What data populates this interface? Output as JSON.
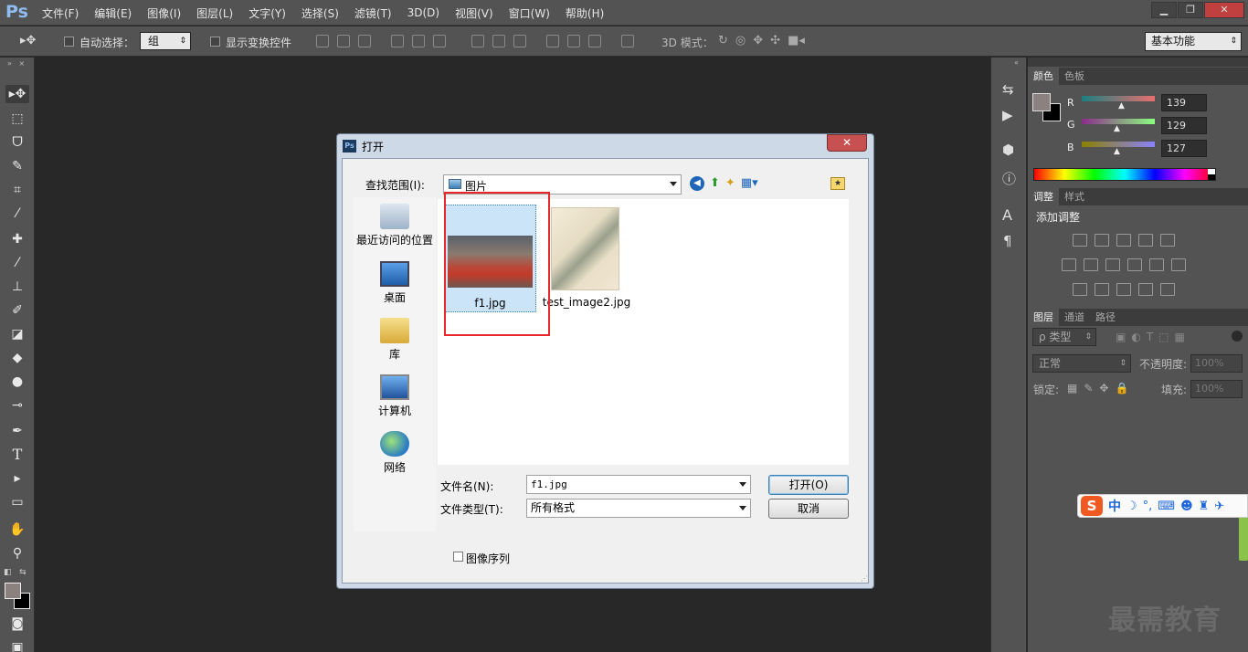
{
  "app": {
    "logo": "Ps",
    "menus": [
      "文件(F)",
      "编辑(E)",
      "图像(I)",
      "图层(L)",
      "文字(Y)",
      "选择(S)",
      "滤镜(T)",
      "3D(D)",
      "视图(V)",
      "窗口(W)",
      "帮助(H)"
    ],
    "window_controls": {
      "minimize": "▁",
      "restore": "❐",
      "close": "✕"
    }
  },
  "options_bar": {
    "auto_select_label": "自动选择：",
    "auto_select_value": "组",
    "show_transform_label": "显示变换控件",
    "mode_3d_label": "3D 模式：",
    "workspace": "基本功能"
  },
  "panels": {
    "color_tabs": [
      "颜色",
      "色板"
    ],
    "rgb": {
      "r_label": "R",
      "g_label": "G",
      "b_label": "B",
      "r": "139",
      "g": "129",
      "b": "127"
    },
    "foreground_color": "#8b817f",
    "adjust_tabs": [
      "调整",
      "样式"
    ],
    "add_adjustment": "添加调整",
    "layers_tabs": [
      "图层",
      "通道",
      "路径"
    ],
    "kind_filter": "ρ 类型",
    "blend_mode": "正常",
    "opacity_label": "不透明度:",
    "opacity_value": "100%",
    "lock_label": "锁定:",
    "fill_label": "填充:",
    "fill_value": "100%"
  },
  "dialog": {
    "title_icon": "Ps",
    "title": "打开",
    "close_label": "✕",
    "lookin_label": "查找范围(I):",
    "lookin_value": "图片",
    "places": [
      {
        "label": "最近访问的位置",
        "icon": "recent-places-icon"
      },
      {
        "label": "桌面",
        "icon": "desktop-icon"
      },
      {
        "label": "库",
        "icon": "libraries-icon"
      },
      {
        "label": "计算机",
        "icon": "computer-icon"
      },
      {
        "label": "网络",
        "icon": "network-icon"
      }
    ],
    "files": [
      {
        "name": "f1.jpg",
        "selected": true
      },
      {
        "name": "test_image2.jpg",
        "selected": false
      }
    ],
    "filename_label": "文件名(N):",
    "filename_value": "f1.jpg",
    "filetype_label": "文件类型(T):",
    "filetype_value": "所有格式",
    "open_button": "打开(O)",
    "cancel_button": "取消",
    "image_sequence_label": "图像序列"
  },
  "ime": {
    "s_logo": "S",
    "mode": "中",
    "icons": [
      "moon-icon",
      "punct-icon",
      "keyboard-icon",
      "user-icon",
      "shirt-icon",
      "wrench-icon"
    ]
  },
  "watermark": "最需教育"
}
